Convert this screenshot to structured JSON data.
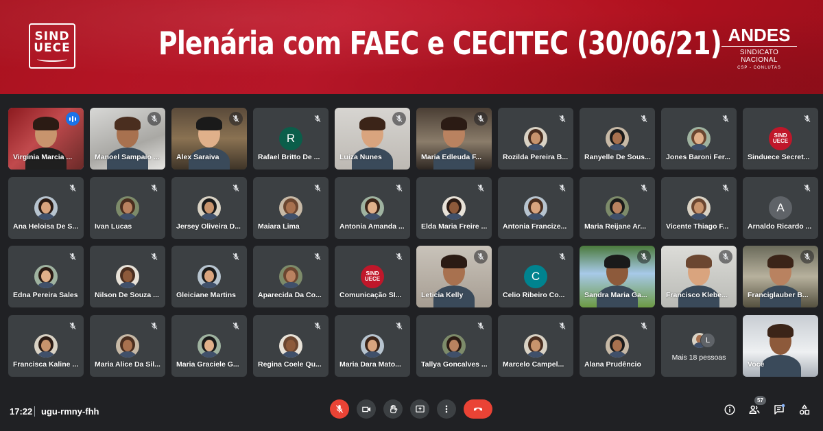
{
  "banner": {
    "title": "Plenária com FAEC e CECITEC (30/06/21)",
    "logo_left": [
      "SIND",
      "UECE"
    ],
    "logo_right": {
      "brand": "ANDES",
      "sub": "SINDICATO NACIONAL",
      "sub2": "CSP - CONLUTAS"
    }
  },
  "meeting": {
    "time": "17:22",
    "code": "ugu-rmny-fhh",
    "participants_count": "57"
  },
  "more_tile": {
    "label": "Mais 18 pessoas",
    "avatar_letter": "L"
  },
  "tiles": [
    {
      "name": "Virginia Marcia ...",
      "kind": "video",
      "speaking": true
    },
    {
      "name": "Manoel Sampaio ...",
      "kind": "video"
    },
    {
      "name": "Alex Saraiva",
      "kind": "video"
    },
    {
      "name": "Rafael Britto De ...",
      "kind": "letter",
      "letter": "R",
      "color": "#0b5e4a"
    },
    {
      "name": "Luiza Nunes",
      "kind": "video"
    },
    {
      "name": "Maria Edleuda F...",
      "kind": "video"
    },
    {
      "name": "Rozilda Pereira B...",
      "kind": "photo"
    },
    {
      "name": "Ranyelle De Sous...",
      "kind": "photo"
    },
    {
      "name": "Jones Baroni Fer...",
      "kind": "photo"
    },
    {
      "name": "Sinduece Secret...",
      "kind": "logo"
    },
    {
      "name": "Ana Heloisa De S...",
      "kind": "photo"
    },
    {
      "name": "Ivan Lucas",
      "kind": "photo"
    },
    {
      "name": "Jersey Oliveira D...",
      "kind": "photo"
    },
    {
      "name": "Maiara Lima",
      "kind": "photo"
    },
    {
      "name": "Antonia Amanda ...",
      "kind": "photo"
    },
    {
      "name": "Elda Maria Freire ...",
      "kind": "photo"
    },
    {
      "name": "Antonia Francize...",
      "kind": "photo"
    },
    {
      "name": "Maria Reijane Ar...",
      "kind": "photo"
    },
    {
      "name": "Vicente Thiago F...",
      "kind": "photo"
    },
    {
      "name": "Arnaldo Ricardo ...",
      "kind": "letter",
      "letter": "A",
      "color": "#5f6368"
    },
    {
      "name": "Edna Pereira Sales",
      "kind": "photo"
    },
    {
      "name": "Nilson De Souza ...",
      "kind": "photo"
    },
    {
      "name": "Gleiciane Martins",
      "kind": "photo"
    },
    {
      "name": "Aparecida Da Co...",
      "kind": "photo"
    },
    {
      "name": "Comunicação SI...",
      "kind": "logo"
    },
    {
      "name": "Leticia Kelly",
      "kind": "video"
    },
    {
      "name": "Celio Ribeiro Co...",
      "kind": "letter",
      "letter": "C",
      "color": "#00838f"
    },
    {
      "name": "Sandra Maria Ga...",
      "kind": "video"
    },
    {
      "name": "Francisco Klebe...",
      "kind": "video"
    },
    {
      "name": "Franciglauber B...",
      "kind": "video"
    },
    {
      "name": "Francisca Kaline ...",
      "kind": "photo"
    },
    {
      "name": "Maria Alice Da Sil...",
      "kind": "photo"
    },
    {
      "name": "Maria Graciele G...",
      "kind": "photo"
    },
    {
      "name": "Regina Coele Qu...",
      "kind": "photo"
    },
    {
      "name": "Maria Dara Mato...",
      "kind": "photo"
    },
    {
      "name": "Tallya Goncalves ...",
      "kind": "photo"
    },
    {
      "name": "Marcelo Campel...",
      "kind": "photo"
    },
    {
      "name": "Alana Prudêncio",
      "kind": "photo"
    },
    {
      "name": "",
      "kind": "more"
    },
    {
      "name": "Você",
      "kind": "video"
    }
  ],
  "colors": {
    "background": "#202124",
    "tile": "#3c4043",
    "banner_red": "#b3111f",
    "accent_blue": "#8ab4f8",
    "end_call_red": "#ea4335"
  },
  "icons": {
    "tile_status": "mic-off-icon",
    "speaking": "audio-level-icon",
    "controls": [
      "mic-off-icon",
      "camera-icon",
      "raise-hand-icon",
      "present-screen-icon",
      "more-options-icon",
      "end-call-icon"
    ],
    "right": [
      "info-icon",
      "people-icon",
      "chat-icon",
      "activities-icon"
    ]
  }
}
